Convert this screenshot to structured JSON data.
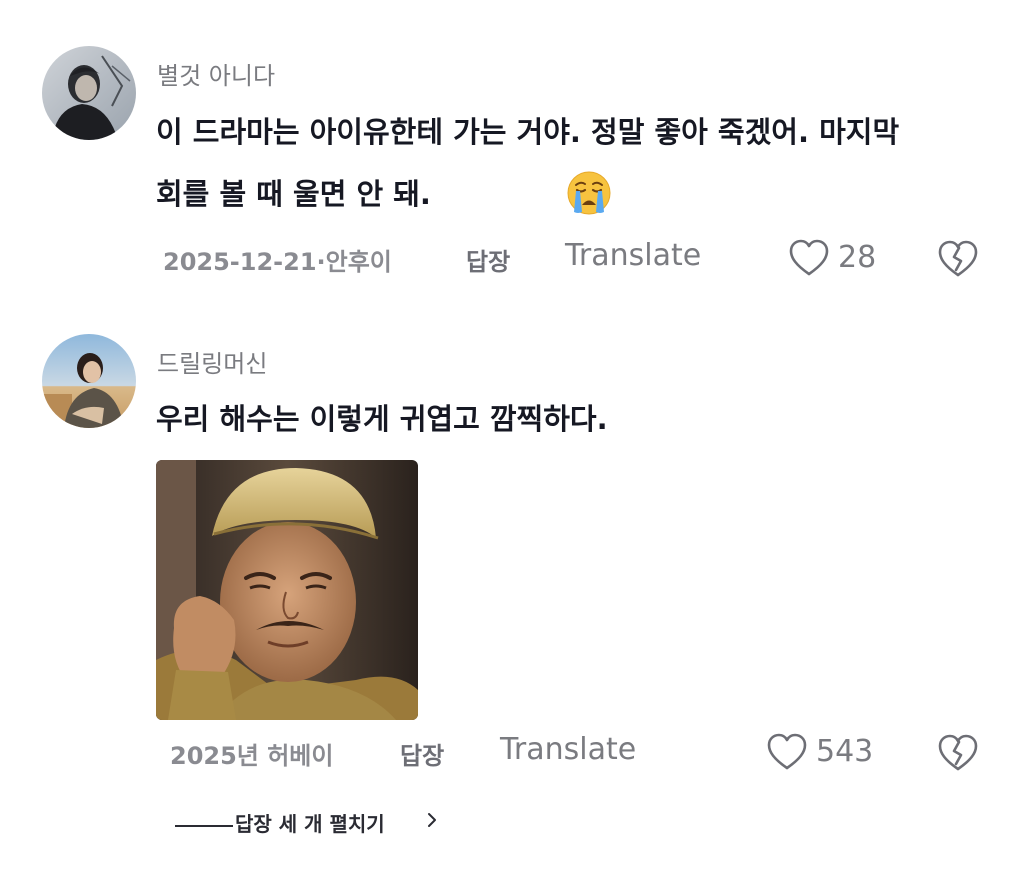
{
  "comments": [
    {
      "username": "별것 아니다",
      "text_line1": "이 드라마는 아이유한테 가는 거야. 정말 좋아 죽겠어. 마지막",
      "text_line2": "회를 볼 때 울면 안 돼.",
      "emoji": "crying-face-icon",
      "date": "2025-12-21·안후이",
      "reply_label": "답장",
      "translate_label": "Translate",
      "like_count": "28"
    },
    {
      "username": "드릴링머신",
      "text_line1": "우리 해수는 이렇게 귀엽고 깜찍하다.",
      "date": "2025년 허베이",
      "reply_label": "답장",
      "translate_label": "Translate",
      "like_count": "543",
      "expand_label": "답장 세 개 펼치기"
    }
  ],
  "colors": {
    "text_primary": "#161823",
    "text_secondary": "#7a7b80",
    "background": "#ffffff"
  }
}
